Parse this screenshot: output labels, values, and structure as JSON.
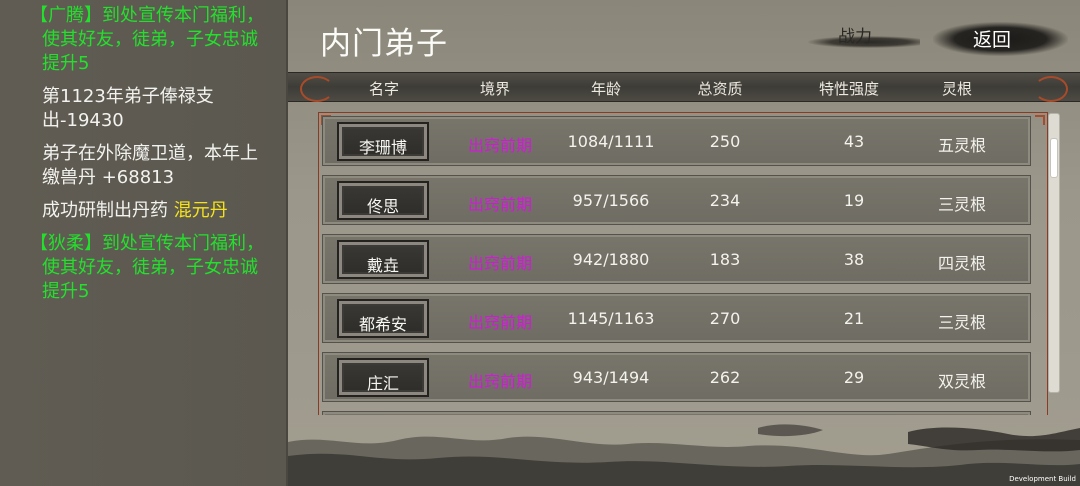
{
  "log": [
    {
      "segments": [
        {
          "text": "【广腾】到处宣传本门福利，使其好友，徒弟，子女忠诚提升5",
          "color": "green"
        }
      ],
      "indent": true
    },
    {
      "segments": [
        {
          "text": "第1123年弟子俸禄支出-19430",
          "color": "white"
        }
      ],
      "indent": false
    },
    {
      "segments": [
        {
          "text": "弟子在外除魔卫道，本年上缴兽丹 +68813",
          "color": "white"
        }
      ],
      "indent": false
    },
    {
      "segments": [
        {
          "text": "成功研制出丹药 ",
          "color": "white"
        },
        {
          "text": "混元丹",
          "color": "yellow"
        }
      ],
      "indent": false
    },
    {
      "segments": [
        {
          "text": "【狄柔】到处宣传本门福利，使其好友，徒弟，子女忠诚提升5",
          "color": "green"
        }
      ],
      "indent": true
    }
  ],
  "header": {
    "title": "内门弟子",
    "power_label": "战力",
    "back_label": "返回"
  },
  "columns": [
    "名字",
    "境界",
    "年龄",
    "总资质",
    "特性强度",
    "灵根"
  ],
  "disciples": [
    {
      "name": "李珊博",
      "realm": "出窍前期",
      "age": "1084/1111",
      "aptitude": "250",
      "trait": "43",
      "root": "五灵根"
    },
    {
      "name": "佟思",
      "realm": "出窍前期",
      "age": "957/1566",
      "aptitude": "234",
      "trait": "19",
      "root": "三灵根"
    },
    {
      "name": "戴垚",
      "realm": "出窍前期",
      "age": "942/1880",
      "aptitude": "183",
      "trait": "38",
      "root": "四灵根"
    },
    {
      "name": "都希安",
      "realm": "出窍前期",
      "age": "1145/1163",
      "aptitude": "270",
      "trait": "21",
      "root": "三灵根"
    },
    {
      "name": "庄汇",
      "realm": "出窍前期",
      "age": "943/1494",
      "aptitude": "262",
      "trait": "29",
      "root": "双灵根"
    }
  ],
  "footer": {
    "build_label": "Development Build"
  },
  "colors": {
    "green": "#23e02c",
    "yellow": "#f5e21b",
    "realm": "#d11ad8",
    "accent": "#a84b2a"
  }
}
